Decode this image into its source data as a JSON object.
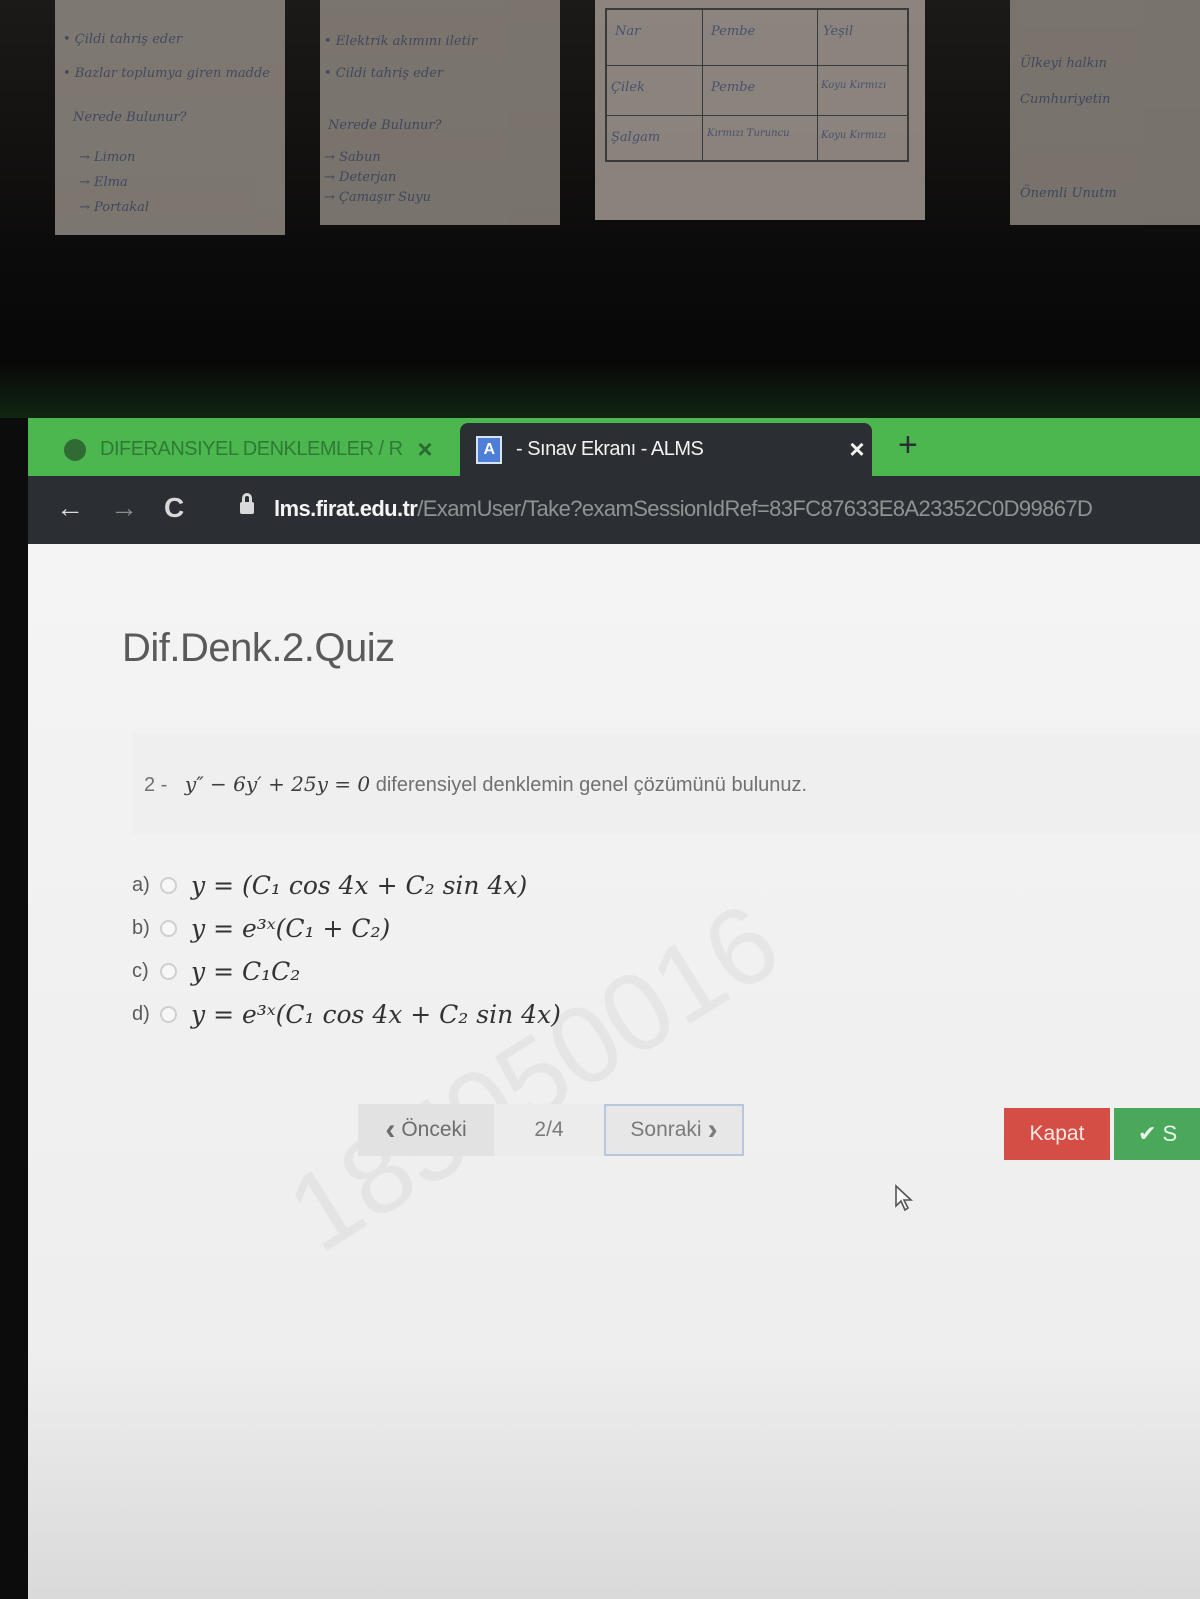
{
  "background": {
    "left_paper_lines": [
      "• Çildi tahriş eder",
      "• Bazlar toplumya giren madde",
      "Nerede Bulunur?",
      "→ Limon",
      "→ Elma",
      "→ Portakal"
    ],
    "middle_paper_lines": [
      "• Elektrik akımını iletir",
      "• Cildi tahriş eder",
      "Nerede Bulunur?",
      "→ Sabun",
      "→ Deterjan",
      "→ Çamaşır Suyu"
    ],
    "table_rows": [
      [
        "Nar",
        "Pembe",
        "Yeşil"
      ],
      [
        "Çilek",
        "Pembe",
        "Koyu Kırmızı"
      ],
      [
        "Şalgam",
        "Kırmızı Turuncu",
        "Koyu Kırmızı"
      ]
    ],
    "right_paper_lines": [
      "Ülkeyi halkın",
      "Cumhuriyetin",
      "Önemli Unutm"
    ]
  },
  "browser": {
    "tabs": [
      {
        "label": "DIFERANSIYEL DENKLEMLER / R",
        "close": "×"
      },
      {
        "label": "- Sınav Ekranı - ALMS",
        "close": "×",
        "icon": "A"
      }
    ],
    "new_tab": "+",
    "nav": {
      "back": "←",
      "forward": "→",
      "reload": "C"
    },
    "url_host": "lms.firat.edu.tr",
    "url_path": "/ExamUser/Take?examSessionIdRef=83FC87633E8A23352C0D99867D"
  },
  "quiz": {
    "title": "Dif.Denk.2.Quiz",
    "question_number": "2 -",
    "question_math": "y″ − 6y′ + 25y = 0",
    "question_text": "diferensiyel denklemin genel çözümünü bulunuz.",
    "options": [
      {
        "label": "a)",
        "math": "y = (C₁ cos 4x + C₂ sin 4x)"
      },
      {
        "label": "b)",
        "math": "y = e³ˣ(C₁ + C₂)"
      },
      {
        "label": "c)",
        "math": "y = C₁C₂"
      },
      {
        "label": "d)",
        "math": "y = e³ˣ(C₁ cos 4x + C₂ sin 4x)"
      }
    ],
    "watermark": "185050016",
    "prev_label": "Önceki",
    "prev_icon": "‹",
    "page_indicator": "2/4",
    "next_label": "Sonraki",
    "next_icon": "›",
    "close_label": "Kapat",
    "finish_label": "✔ S"
  },
  "colors": {
    "tabbar": "#4cb74f",
    "addressbar": "#2b2f33",
    "close_button": "#d54e45",
    "finish_button": "#4aa85b"
  }
}
